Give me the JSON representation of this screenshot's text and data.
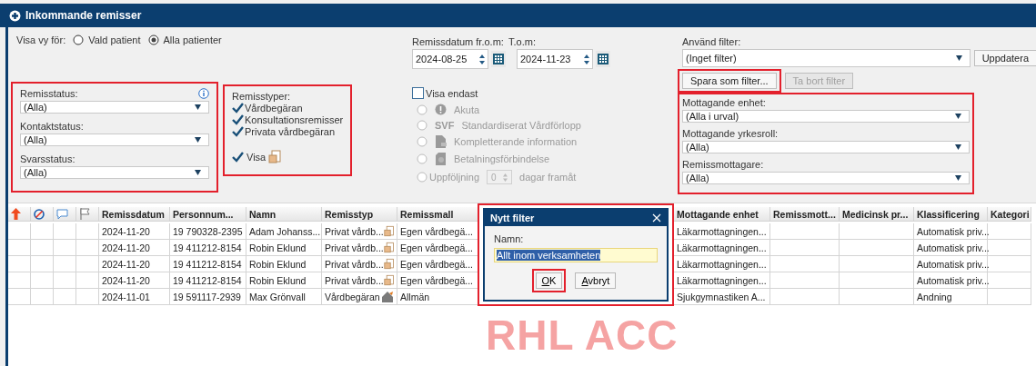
{
  "window": {
    "title": "Inkommande remisser"
  },
  "view_for": {
    "label": "Visa vy för:",
    "options": [
      {
        "label": "Vald patient",
        "selected": false
      },
      {
        "label": "Alla patienter",
        "selected": true
      }
    ]
  },
  "status_filters": {
    "highlighted": true,
    "fields": [
      {
        "label": "Remisstatus:",
        "value": "(Alla)",
        "info": true
      },
      {
        "label": "Kontaktstatus:",
        "value": "(Alla)",
        "info": false
      },
      {
        "label": "Svarsstatus:",
        "value": "(Alla)",
        "info": false
      }
    ]
  },
  "referral_types": {
    "highlighted": true,
    "title": "Remisstyper:",
    "items": [
      {
        "label": "Vårdbegäran",
        "checked": true
      },
      {
        "label": "Konsultationsremisser",
        "checked": true
      },
      {
        "label": "Privata vårdbegäran",
        "checked": true
      }
    ],
    "show": {
      "label": "Visa",
      "checked": true
    }
  },
  "date_range": {
    "from": {
      "label": "Remissdatum fr.o.m:",
      "value": "2024-08-25"
    },
    "to": {
      "label": "T.o.m:",
      "value": "2024-11-23"
    }
  },
  "show_only": {
    "label": "Visa endast",
    "checked": false,
    "options": [
      {
        "kind": "alert",
        "label": "Akuta",
        "disabled": true,
        "selected": false
      },
      {
        "kind": "svf",
        "tag": "SVF",
        "label": "Standardiserat Vårdförlopp",
        "disabled": true,
        "selected": false
      },
      {
        "kind": "document",
        "label": "Kompletterande information",
        "disabled": true,
        "selected": false
      },
      {
        "kind": "payment",
        "label": "Betalningsförbindelse",
        "disabled": true,
        "selected": false
      },
      {
        "kind": "followup",
        "label": "Uppföljning",
        "value": "0",
        "suffix": "dagar framåt",
        "disabled": true,
        "selected": false
      }
    ]
  },
  "filter": {
    "label": "Använd filter:",
    "value": "(Inget filter)",
    "update_button": "Uppdatera",
    "save_button": {
      "label": "Spara som filter...",
      "highlighted": true,
      "disabled": false
    },
    "delete_button": {
      "label": "Ta bort filter",
      "disabled": true
    }
  },
  "receiver_filters": {
    "highlighted": true,
    "fields": [
      {
        "label": "Mottagande enhet:",
        "value": "(Alla i urval)"
      },
      {
        "label": "Mottagande yrkesroll:",
        "value": "(Alla)"
      },
      {
        "label": "Remissmottagare:",
        "value": "(Alla)"
      }
    ]
  },
  "table": {
    "icon_columns": [
      {
        "kind": "priority"
      },
      {
        "kind": "blocked"
      },
      {
        "kind": "comment"
      },
      {
        "kind": "flag"
      }
    ],
    "left_columns": [
      "Remissdatum",
      "Personnum...",
      "Namn",
      "Remisstyp",
      "Remissmall"
    ],
    "right_columns": [
      "Mottagande enhet",
      "Remissmott...",
      "Medicinsk pr...",
      "Klassificering",
      "Kategori"
    ],
    "rows": [
      {
        "kind": "private",
        "left": [
          "2024-11-20",
          "19 790328-2395",
          "Adam Johanss...",
          "Privat vårdb...",
          "Egen vårdbegä..."
        ],
        "receiving_unit": "Läkarmottagningen...",
        "classification": "Automatisk priv..."
      },
      {
        "kind": "private",
        "left": [
          "2024-11-20",
          "19 411212-8154",
          "Robin Eklund",
          "Privat vårdb...",
          "Egen vårdbegä..."
        ],
        "receiving_unit": "Läkarmottagningen...",
        "classification": "Automatisk priv..."
      },
      {
        "kind": "private",
        "left": [
          "2024-11-20",
          "19 411212-8154",
          "Robin Eklund",
          "Privat vårdb...",
          "Egen vårdbegä..."
        ],
        "receiving_unit": "Läkarmottagningen...",
        "classification": "Automatisk priv..."
      },
      {
        "kind": "private",
        "left": [
          "2024-11-20",
          "19 411212-8154",
          "Robin Eklund",
          "Privat vårdb...",
          "Egen vårdbegä..."
        ],
        "receiving_unit": "Läkarmottagningen...",
        "classification": "Automatisk priv..."
      },
      {
        "kind": "referral",
        "left": [
          "2024-11-01",
          "19 591117-2939",
          "Max Grönvall",
          "Vårdbegäran",
          "Allmän"
        ],
        "receiving_unit": "Sjukgymnastiken A...",
        "classification": "Andning"
      }
    ]
  },
  "dialog": {
    "title": "Nytt filter",
    "highlighted": true,
    "field": {
      "label": "Namn:",
      "value": "Allt inom verksamheten",
      "text_selected": true
    },
    "buttons": [
      {
        "label": "OK",
        "highlighted": true
      },
      {
        "label": "Avbryt",
        "highlighted": false
      }
    ]
  },
  "environment_label": "RHL ACC"
}
